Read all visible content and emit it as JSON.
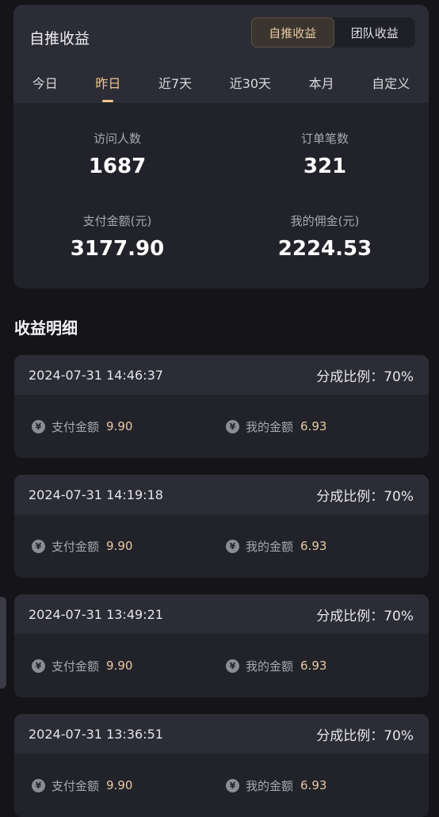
{
  "summary": {
    "title": "自推收益",
    "toggle": [
      {
        "label": "自推收益",
        "active": true
      },
      {
        "label": "团队收益",
        "active": false
      }
    ],
    "periods": [
      {
        "label": "今日",
        "active": false
      },
      {
        "label": "昨日",
        "active": true
      },
      {
        "label": "近7天",
        "active": false
      },
      {
        "label": "近30天",
        "active": false
      },
      {
        "label": "本月",
        "active": false
      },
      {
        "label": "自定义",
        "active": false
      }
    ],
    "stats": [
      {
        "label": "访问人数",
        "value": "1687"
      },
      {
        "label": "订单笔数",
        "value": "321"
      },
      {
        "label": "支付金额(元)",
        "value": "3177.90"
      },
      {
        "label": "我的佣金(元)",
        "value": "2224.53"
      }
    ]
  },
  "details": {
    "title": "收益明细",
    "pay_label": "支付金额",
    "mine_label": "我的金额",
    "ratio_label": "分成比例：",
    "currency_icon": "yen-icon",
    "entries": [
      {
        "time": "2024-07-31 14:46:37",
        "ratio": "70%",
        "pay": "9.90",
        "mine": "6.93"
      },
      {
        "time": "2024-07-31 14:19:18",
        "ratio": "70%",
        "pay": "9.90",
        "mine": "6.93"
      },
      {
        "time": "2024-07-31 13:49:21",
        "ratio": "70%",
        "pay": "9.90",
        "mine": "6.93"
      },
      {
        "time": "2024-07-31 13:36:51",
        "ratio": "70%",
        "pay": "9.90",
        "mine": "6.93"
      }
    ]
  },
  "colors": {
    "accent": "#f2c58c",
    "background": "#141419",
    "card": "#22232a"
  }
}
